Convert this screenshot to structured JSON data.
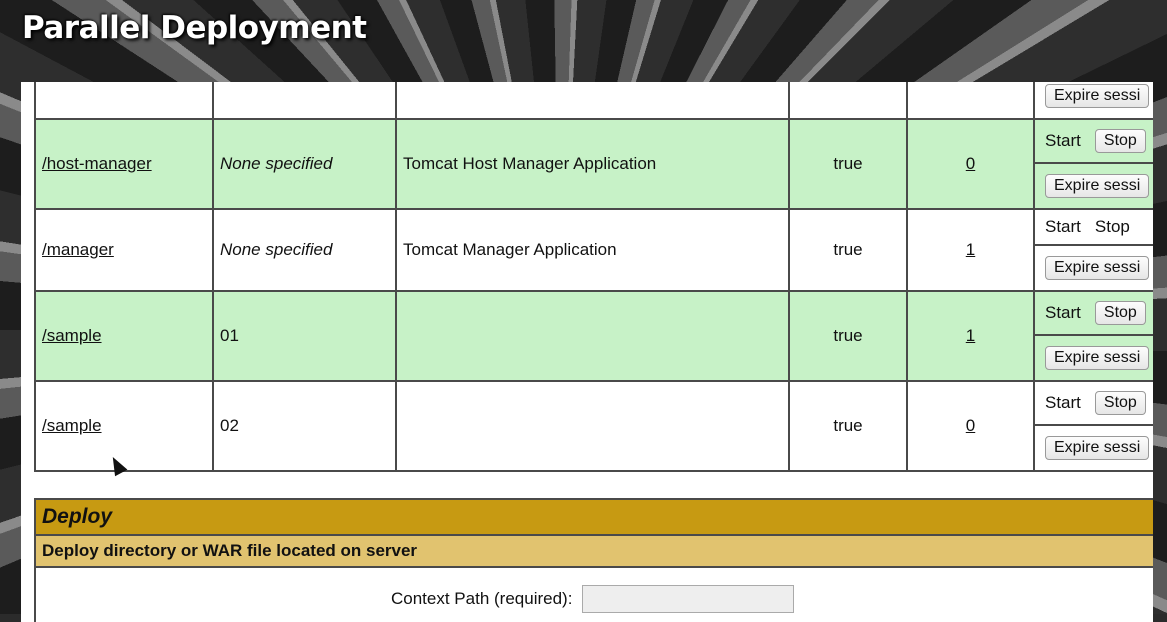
{
  "banner": {
    "title": "Parallel Deployment"
  },
  "apps": {
    "partial_row": {
      "expire_label": "Expire sessi"
    },
    "rows": [
      {
        "path": "/host-manager",
        "version": "None specified",
        "display_name": "Tomcat Host Manager Application",
        "running": "true",
        "sessions": "0",
        "start_label": "Start",
        "stop_label": "Stop",
        "expire_label": "Expire sessi",
        "stop_is_button": true
      },
      {
        "path": "/manager",
        "version": "None specified",
        "display_name": "Tomcat Manager Application",
        "running": "true",
        "sessions": "1",
        "start_label": "Start",
        "stop_label": "Stop",
        "expire_label": "Expire sessi",
        "stop_is_button": false
      },
      {
        "path": "/sample",
        "version": "01",
        "display_name": "",
        "running": "true",
        "sessions": "1",
        "start_label": "Start",
        "stop_label": "Stop",
        "expire_label": "Expire sessi",
        "stop_is_button": true
      },
      {
        "path": "/sample",
        "version": "02",
        "display_name": "",
        "running": "true",
        "sessions": "0",
        "start_label": "Start",
        "stop_label": "Stop",
        "expire_label": "Expire sessi",
        "stop_is_button": true
      }
    ]
  },
  "deploy": {
    "title": "Deploy",
    "subtitle": "Deploy directory or WAR file located on server",
    "context_path_label": "Context Path (required):",
    "context_path_value": ""
  },
  "colors": {
    "row_green": "#c7f2c7",
    "deploy_header": "#c79a12",
    "deploy_subheader": "#e1c36f"
  }
}
